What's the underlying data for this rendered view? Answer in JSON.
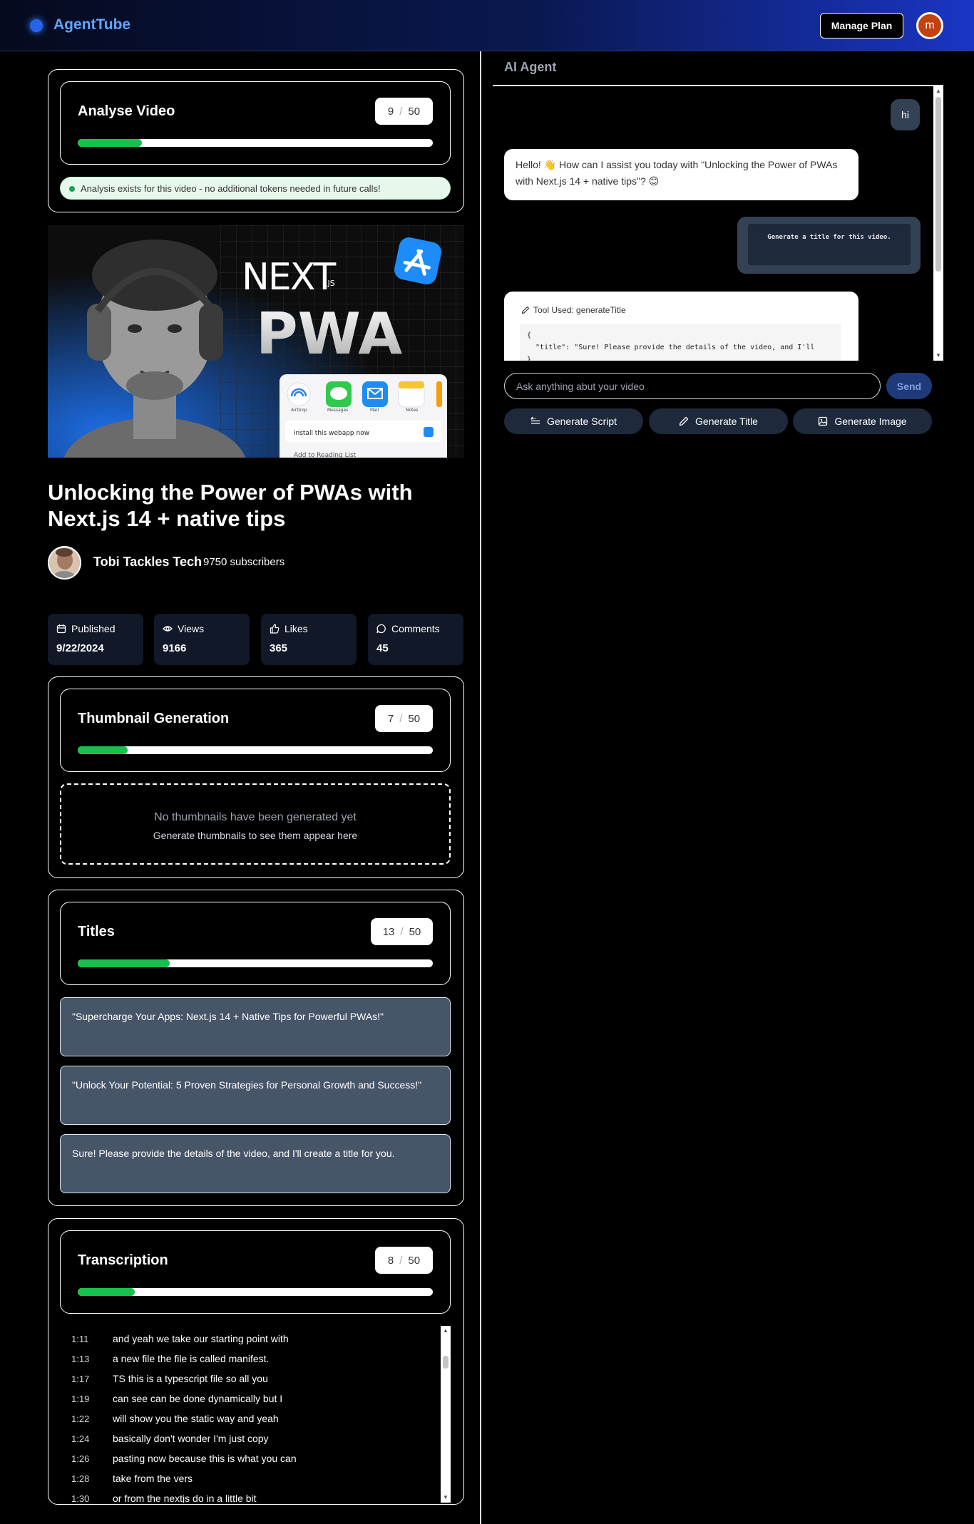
{
  "header": {
    "app_name": "AgentTube",
    "manage_plan_label": "Manage Plan",
    "avatar_initial": "m"
  },
  "analyse": {
    "title": "Analyse Video",
    "used": "9",
    "separator": "/",
    "limit": "50",
    "progress": 0.18,
    "notice": "Analysis exists for this video - no additional tokens needed in future calls!"
  },
  "thumbnail_image": {
    "brand_text": "NEXT",
    "brand_suffix": ".JS",
    "headline": "PWA",
    "app_icons": [
      "AirDrop",
      "Messages",
      "Mail",
      "Notes"
    ],
    "sheet_item_1": "install this webapp now",
    "sheet_item_2": "Add to Reading List"
  },
  "video": {
    "title": "Unlocking the Power of PWAs with Next.js 14 + native tips",
    "channel_name": "Tobi Tackles Tech",
    "subscribers": "9750 subscribers"
  },
  "stats": [
    {
      "label": "Published",
      "value": "9/22/2024",
      "icon": "calendar-icon"
    },
    {
      "label": "Views",
      "value": "9166",
      "icon": "eye-icon"
    },
    {
      "label": "Likes",
      "value": "365",
      "icon": "thumbs-up-icon"
    },
    {
      "label": "Comments",
      "value": "45",
      "icon": "comment-icon"
    }
  ],
  "thumbnail_generation": {
    "title": "Thumbnail Generation",
    "used": "7",
    "separator": "/",
    "limit": "50",
    "progress": 0.14,
    "empty_title": "No thumbnails have been generated yet",
    "empty_sub": "Generate thumbnails to see them appear here"
  },
  "titles": {
    "title": "Titles",
    "used": "13",
    "separator": "/",
    "limit": "50",
    "progress": 0.26,
    "items": [
      "\"Supercharge Your Apps: Next.js 14 + Native Tips for Powerful PWAs!\"",
      "\"Unlock Your Potential: 5 Proven Strategies for Personal Growth and Success!\"",
      "Sure! Please provide the details of the video, and I'll create a title for you."
    ]
  },
  "transcription": {
    "title": "Transcription",
    "used": "8",
    "separator": "/",
    "limit": "50",
    "progress": 0.16,
    "rows": [
      {
        "time": "1:11",
        "text": "and yeah we take our starting point with"
      },
      {
        "time": "1:13",
        "text": "a new file the file is called manifest."
      },
      {
        "time": "1:17",
        "text": "TS this is a typescript file so all you"
      },
      {
        "time": "1:19",
        "text": "can see can be done dynamically but I"
      },
      {
        "time": "1:22",
        "text": "will show you the static way and yeah"
      },
      {
        "time": "1:24",
        "text": "basically don't wonder I'm just copy"
      },
      {
        "time": "1:26",
        "text": "pasting now because this is what you can"
      },
      {
        "time": "1:28",
        "text": "take from the vers"
      },
      {
        "time": "1:30",
        "text": "or from the nextjs do in a little bit"
      }
    ]
  },
  "agent": {
    "heading": "AI Agent",
    "messages": {
      "user_1": "hi",
      "ai_1": "Hello! 👋 How can I assist you today with \"Unlocking the Power of PWAs with Next.js 14 + native tips\"? 😊",
      "user_2": "Generate a title for this video.",
      "tool_label": "Tool Used: generateTitle",
      "tool_code": "{\n  \"title\": \"Sure! Please provide the details of the video, and I'll\n}"
    },
    "input_placeholder": "Ask anything abut your video",
    "send_label": "Send",
    "actions": [
      {
        "label": "Generate Script",
        "icon": "script-icon"
      },
      {
        "label": "Generate Title",
        "icon": "pencil-icon"
      },
      {
        "label": "Generate Image",
        "icon": "image-icon"
      }
    ]
  }
}
